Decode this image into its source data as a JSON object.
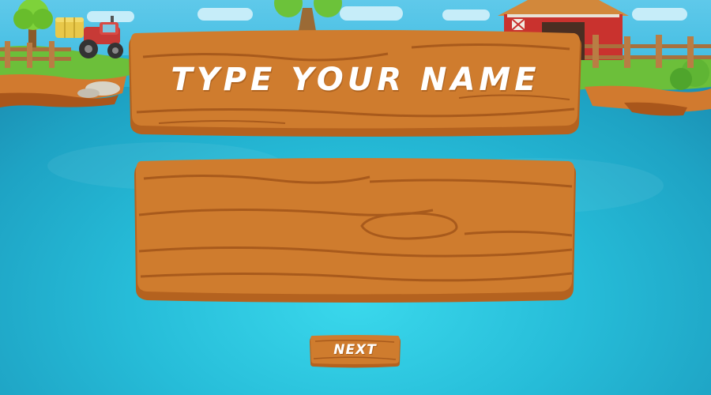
{
  "screen": {
    "title": "TYPE YOUR NAME",
    "name_input": {
      "value": "",
      "placeholder": ""
    },
    "next_label": "NEXT"
  },
  "colors": {
    "wood": "#cf7c2e",
    "wood_grain": "#a85a1c",
    "wood_edge": "#b4621f",
    "water": "#26bcd8",
    "text": "#ffffff"
  },
  "icons": [
    "tractor-icon",
    "barn-icon",
    "tree-icon",
    "fence-icon",
    "hay-bale-icon"
  ]
}
